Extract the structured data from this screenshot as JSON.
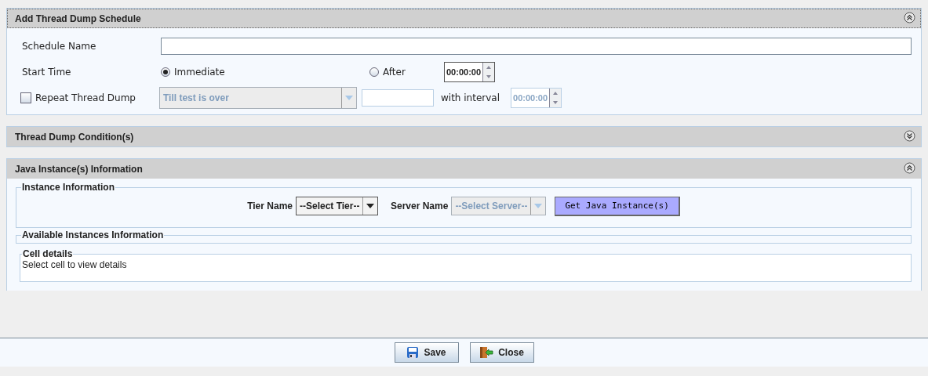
{
  "schedule": {
    "title": "Add Thread Dump Schedule",
    "expanded": true,
    "name_label": "Schedule Name",
    "start_label": "Start Time",
    "start_options": [
      {
        "label": "Immediate",
        "selected": true
      },
      {
        "label": "After",
        "selected": false
      }
    ],
    "after_time": "00:00:00",
    "repeat": {
      "label": "Repeat Thread Dump",
      "checked": false,
      "select_value": "Till test is over",
      "disabled": true
    },
    "interval_label": "with interval",
    "interval_time": "00:00:00"
  },
  "condition": {
    "title": "Thread Dump Condition(s)",
    "expanded": false
  },
  "java": {
    "title": "Java Instance(s) Information",
    "expanded": true,
    "instance_legend": "Instance Information",
    "tier_label": "Tier Name",
    "tier_value": "--Select Tier--",
    "server_label": "Server Name",
    "server_value": "--Select Server--",
    "server_disabled": true,
    "get_button": "Get Java Instance(s)",
    "available_legend": "Available Instances Information",
    "cell_legend": "Cell details",
    "cell_text": "Select cell to view details"
  },
  "buttons": [
    {
      "kind": "save",
      "label": "Save"
    },
    {
      "kind": "close",
      "label": "Close"
    }
  ]
}
